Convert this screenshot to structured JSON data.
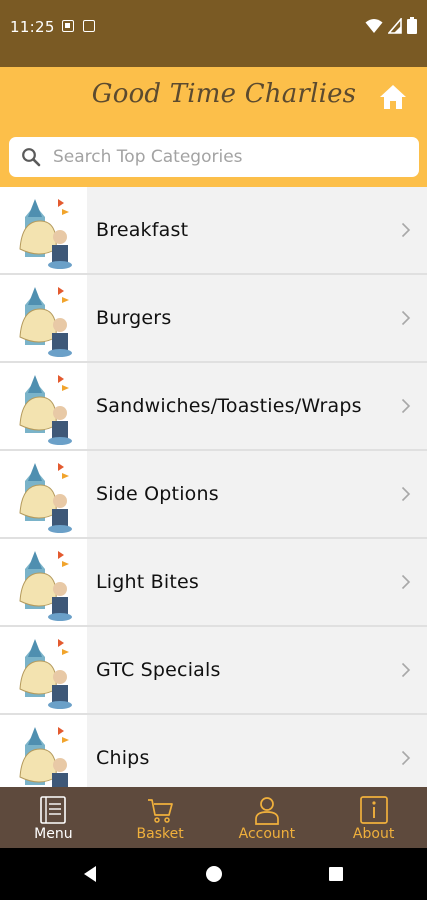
{
  "status_bar": {
    "time": "11:25",
    "icons": [
      "notification-icon",
      "calendar-icon",
      "wifi-icon",
      "signal-icon",
      "battery-icon"
    ]
  },
  "header": {
    "title": "Good Time Charlies",
    "home_icon": "home-icon",
    "background_color": "#fcbf4a",
    "title_color": "#5b4a2f"
  },
  "search": {
    "placeholder": "Search Top Categories",
    "value": ""
  },
  "categories": [
    {
      "label": "Breakfast"
    },
    {
      "label": "Burgers"
    },
    {
      "label": "Sandwiches/Toasties/Wraps"
    },
    {
      "label": "Side Options"
    },
    {
      "label": "Light Bites"
    },
    {
      "label": "GTC Specials"
    },
    {
      "label": "Chips"
    }
  ],
  "bottom_nav": {
    "items": [
      {
        "label": "Menu",
        "icon": "menu-book-icon",
        "active": true
      },
      {
        "label": "Basket",
        "icon": "basket-cart-icon",
        "active": false
      },
      {
        "label": "Account",
        "icon": "account-person-icon",
        "active": false
      },
      {
        "label": "About",
        "icon": "info-icon",
        "active": false
      }
    ],
    "background_color": "#5e4a3d",
    "accent_color": "#f0b03c"
  },
  "system_nav": {
    "icons": [
      "back-icon",
      "home-circle-icon",
      "recents-icon"
    ]
  }
}
